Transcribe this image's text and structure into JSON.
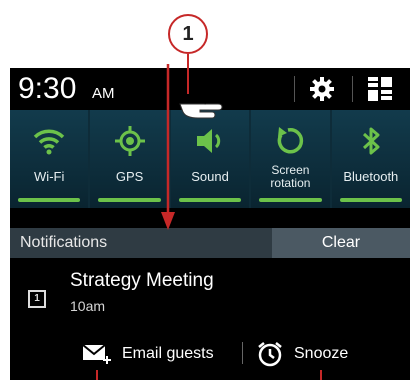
{
  "callout": {
    "number": "1"
  },
  "status": {
    "time": "9:30",
    "ampm": "AM"
  },
  "toggles": [
    {
      "label": "Wi-Fi",
      "icon": "wifi-icon",
      "on": true
    },
    {
      "label": "GPS",
      "icon": "gps-icon",
      "on": true
    },
    {
      "label": "Sound",
      "icon": "sound-icon",
      "on": true
    },
    {
      "label": "Screen rotation",
      "label_line1": "Screen",
      "label_line2": "rotation",
      "icon": "rotation-icon",
      "on": true
    },
    {
      "label": "Bluetooth",
      "icon": "bluetooth-icon",
      "on": true
    }
  ],
  "notifications": {
    "header": "Notifications",
    "clear_label": "Clear",
    "item": {
      "icon_day": "1",
      "title": "Strategy Meeting",
      "subtitle": "10am",
      "actions": [
        {
          "label": "Email guests",
          "icon": "email-add-icon"
        },
        {
          "label": "Snooze",
          "icon": "alarm-clock-icon"
        }
      ]
    }
  },
  "colors": {
    "accent_green": "#6cc24a",
    "annotation_red": "#c62828",
    "toggle_blue": "#0e2c39"
  }
}
